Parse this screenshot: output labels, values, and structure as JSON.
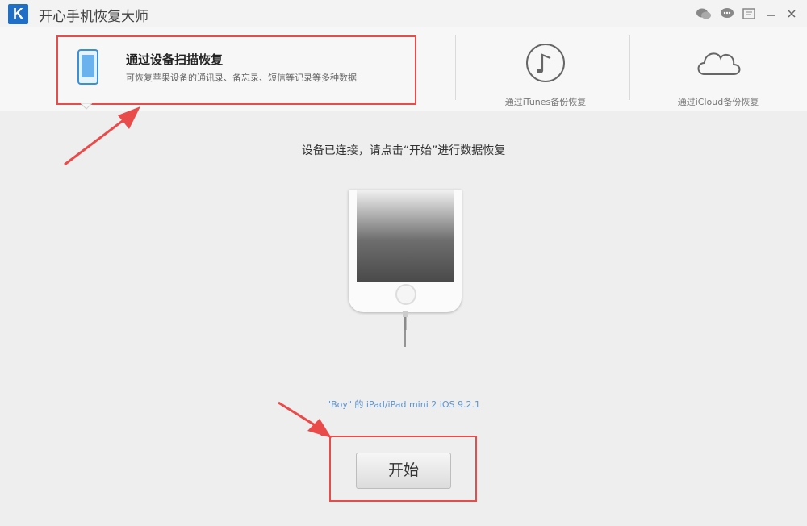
{
  "titlebar": {
    "app_title": "开心手机恢复大师",
    "logo_letter": "K",
    "controls": [
      "wechat-icon",
      "chat-icon",
      "feedback-icon",
      "minimize-icon",
      "close-icon"
    ]
  },
  "modes": {
    "active": {
      "title": "通过设备扫描恢复",
      "description": "可恢复苹果设备的通讯录、备忘录、短信等记录等多种数据"
    },
    "itunes": {
      "label": "通过iTunes备份恢复"
    },
    "icloud": {
      "label": "通过iCloud备份恢复"
    }
  },
  "main": {
    "instruction": "设备已连接，请点击“开始”进行数据恢复",
    "device_info": "\"Boy\" 的 iPad/iPad mini 2 iOS 9.2.1",
    "start_label": "开始"
  },
  "colors": {
    "annotation_red": "#e94b4b",
    "accent_blue": "#3a8fd9",
    "device_info_blue": "#5c93d1"
  }
}
